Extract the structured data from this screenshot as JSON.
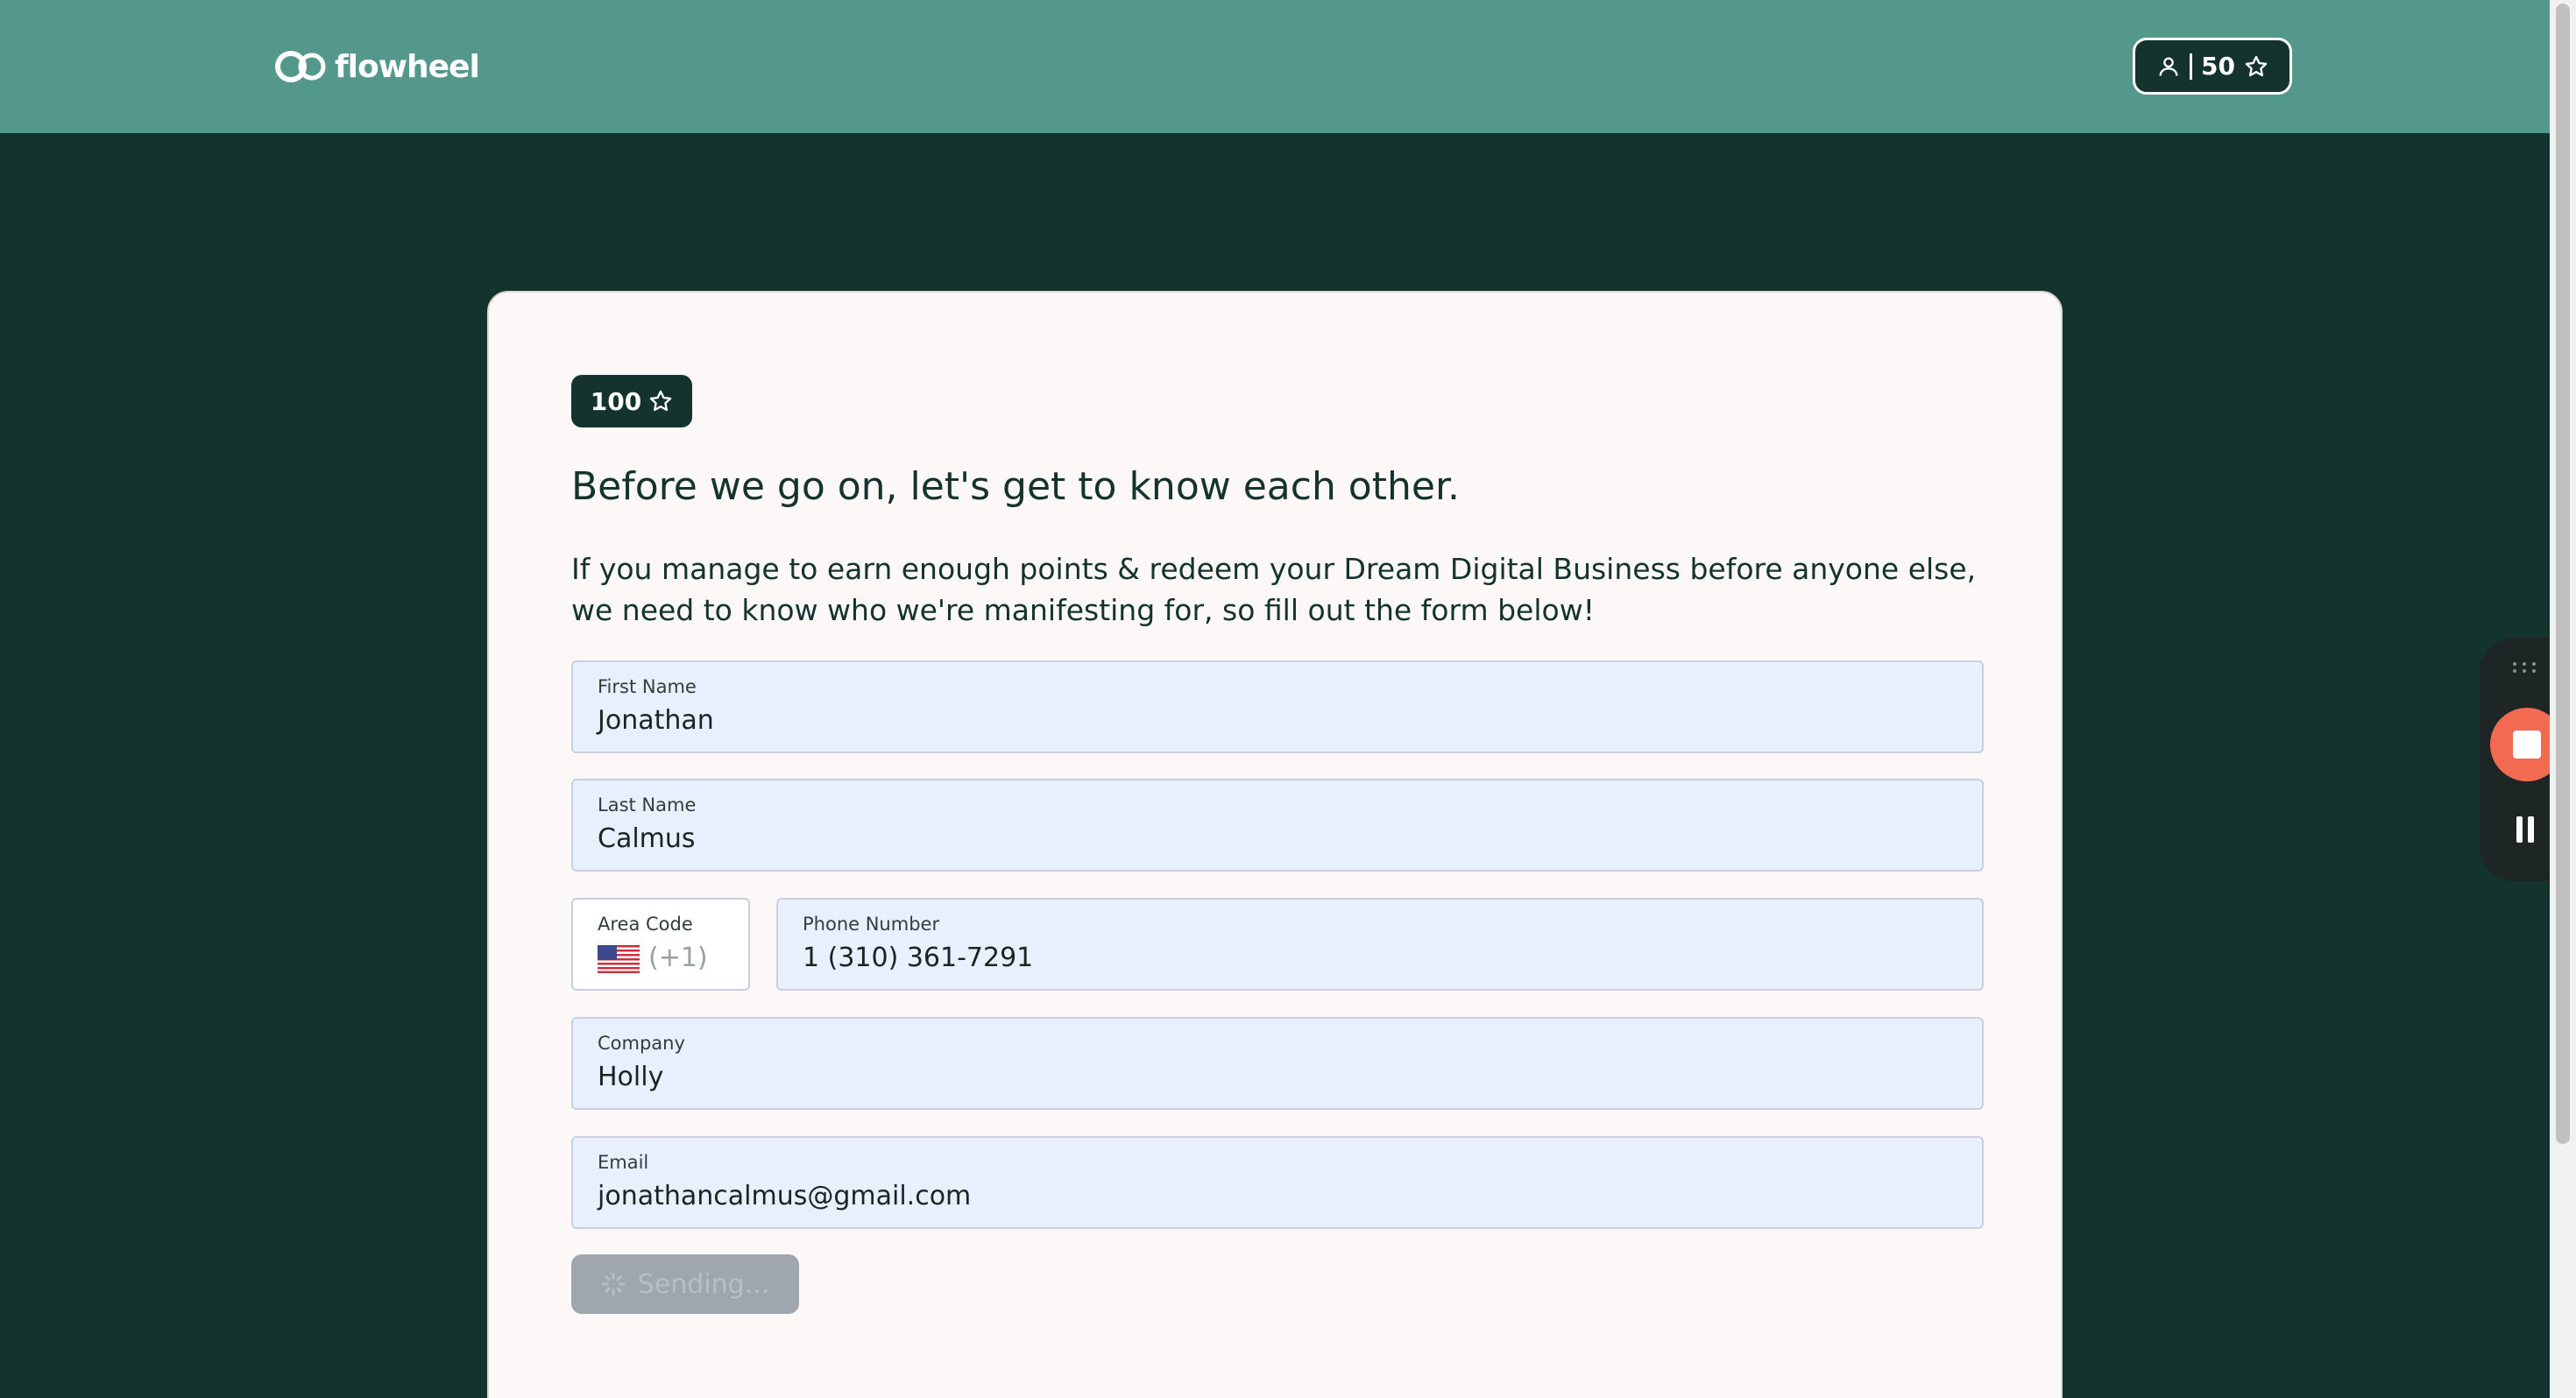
{
  "header": {
    "logo_text": "flowheel",
    "points": "50"
  },
  "card": {
    "badge_points": "100",
    "heading": "Before we go on, let's get to know each other.",
    "intro": "If you manage to earn enough points & redeem your Dream Digital Business before anyone else, we need to know who we're manifesting for, so fill out the form below!",
    "fields": {
      "first_name": {
        "label": "First Name",
        "value": "Jonathan"
      },
      "last_name": {
        "label": "Last Name",
        "value": "Calmus"
      },
      "area_code": {
        "label": "Area Code",
        "value": "(+1)"
      },
      "phone": {
        "label": "Phone Number",
        "value": "1 (310) 361-7291"
      },
      "company": {
        "label": "Company",
        "value": "Holly"
      },
      "email": {
        "label": "Email",
        "value": "jonathancalmus@gmail.com"
      }
    },
    "submit_label": "Sending..."
  },
  "colors": {
    "header_bg": "#53988a",
    "page_bg": "#14332d",
    "field_bg": "#e8effd",
    "record_stop": "#f26b50"
  },
  "icons": [
    "user-icon",
    "star-icon",
    "us-flag-icon",
    "spinner-icon",
    "drag-handle-icon",
    "stop-icon",
    "pause-icon"
  ]
}
